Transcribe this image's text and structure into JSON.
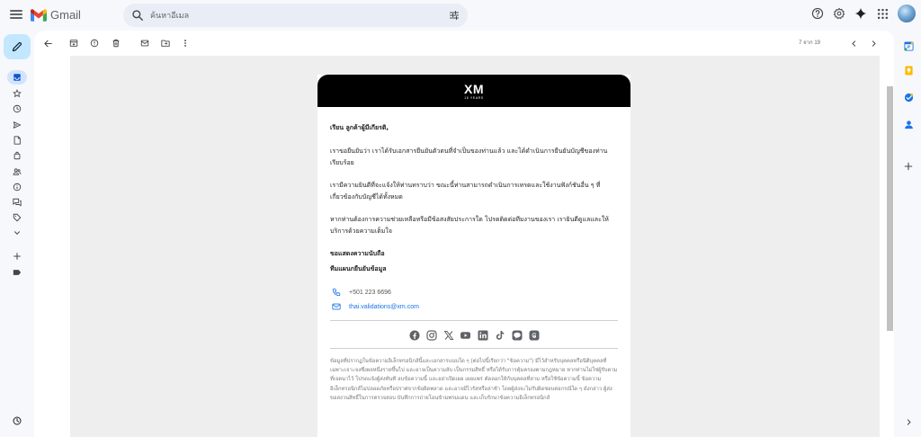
{
  "app": {
    "name": "Gmail",
    "colors": {
      "accent": "#1a73e8",
      "compose_bg": "#c2e7ff",
      "active_bg": "#d3e3fd",
      "header_bg": "#000000"
    }
  },
  "search": {
    "placeholder": "ค้นหาอีเมล",
    "value": ""
  },
  "top_icons": [
    "help-icon",
    "settings-icon",
    "gemini-icon",
    "apps-icon",
    "account-avatar"
  ],
  "rail_icons": [
    "compose-icon",
    "inbox-icon",
    "starred-icon",
    "snoozed-icon",
    "sent-icon",
    "drafts-icon",
    "purchases-icon",
    "social-icon",
    "updates-icon",
    "forums-icon",
    "label-icon",
    "more-icon",
    "create-label-icon",
    "label-tag-icon",
    "activity-icon"
  ],
  "toolbar": {
    "icons": [
      "back-icon",
      "archive-icon",
      "report-spam-icon",
      "delete-icon",
      "mark-unread-icon",
      "move-to-icon",
      "more-options-icon"
    ],
    "pager_label": "7 จาก 19"
  },
  "email": {
    "logo": "XM",
    "logo_sub": "15 YEARS",
    "greeting": "เรียน ลูกค้าผู้มีเกียรติ,",
    "paragraphs": [
      "เราขอยืนยันว่า เราได้รับเอกสารยืนยันตัวตนที่จำเป็นของท่านแล้ว และได้ดำเนินการยืนยันบัญชีของท่านเรียบร้อย",
      "เรามีความยินดีที่จะแจ้งให้ท่านทราบว่า ขณะนี้ท่านสามารถดำเนินการเทรดและใช้งานฟังก์ชันอื่น ๆ ที่เกี่ยวข้องกับบัญชีได้ทั้งหมด",
      "หากท่านต้องการความช่วยเหลือหรือมีข้อสงสัยประการใด โปรดติดต่อทีมงานของเรา เรายินดีดูแลและให้บริการด้วยความเต็มใจ"
    ],
    "sign_off": "ขอแสดงความนับถือ",
    "team": "ทีมแผนกยืนยันข้อมูล",
    "phone": "+501 223 6696",
    "mail": "thai.validations@xm.com",
    "socials": [
      "facebook-icon",
      "instagram-icon",
      "x-icon",
      "youtube-icon",
      "linkedin-icon",
      "tiktok-icon",
      "line-icon",
      "threads-icon"
    ],
    "disclaimer": "ข้อมูลที่ปรากฏในข้อความอิเล็กทรอนิกส์นี้และเอกสารแนบใด ๆ (ต่อไปนี้เรียกว่า \"ข้อความ\") มีไว้สำหรับบุคคลหรือนิติบุคคลที่เฉพาะเจาะจงซึ่งผลหนึ่งรายขึ้นไป และอาจเป็นความลับ เป็นกรรมสิทธิ์ หรือได้รับการคุ้มครองตามกฎหมาย หากท่านไม่ใช่ผู้รับตามที่เจตนาไว้ โปรดแจ้งผู้ส่งทันที ลบข้อความนี้ และอย่าเปิดเผย เผยแพร่ คัดลอกให้กับบุคคลที่สาม หรือใช้ข้อความนี้ ข้อความอิเล็กทรอนิกส์ไม่ปลอดภัยหรือปราศจากข้อผิดพลาด และอาจมีไวรัสหรือล่าช้า โดยผู้ส่งจะไม่รับผิดชอบต่อกรณีใด ๆ ดังกล่าว ผู้ส่งขอสงวนสิทธิ์ในการตรวจสอบ บันทึกการถ่ายโอนข้ามพรมแดน และเก็บรักษาข้อความอิเล็กทรอนิกส์"
  },
  "right_rail_icons": [
    "calendar-icon",
    "keep-icon",
    "tasks-icon",
    "contacts-icon",
    "get-addons-icon",
    "collapse-panel-icon"
  ]
}
